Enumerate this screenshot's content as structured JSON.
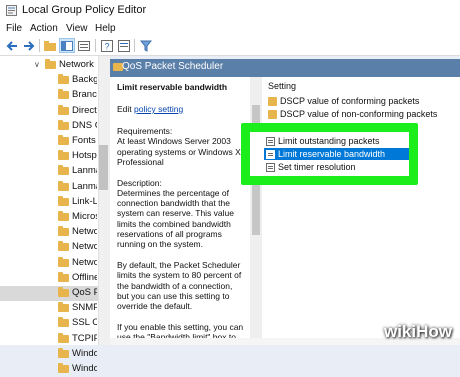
{
  "window": {
    "title": "Local Group Policy Editor"
  },
  "menu": [
    "File",
    "Action",
    "View",
    "Help"
  ],
  "toolbar": {
    "icons": [
      "back-arrow-icon",
      "forward-arrow-icon",
      "up-folder-icon",
      "show-hide-tree-icon",
      "export-list-icon",
      "help-icon",
      "properties-icon",
      "filter-icon"
    ]
  },
  "tree": {
    "items": [
      {
        "label": "Network",
        "indent": 1,
        "expanded": true
      },
      {
        "label": "Backgr",
        "indent": 2
      },
      {
        "label": "Branch",
        "indent": 2
      },
      {
        "label": "DirectA",
        "indent": 2
      },
      {
        "label": "DNS C",
        "indent": 2
      },
      {
        "label": "Fonts",
        "indent": 2
      },
      {
        "label": "Hotspo",
        "indent": 2
      },
      {
        "label": "Lanma",
        "indent": 2
      },
      {
        "label": "Lanma",
        "indent": 2
      },
      {
        "label": "Link-La",
        "indent": 2
      },
      {
        "label": "Micros",
        "indent": 2
      },
      {
        "label": "Netwo",
        "indent": 2
      },
      {
        "label": "Netwo",
        "indent": 2
      },
      {
        "label": "Netwo",
        "indent": 2
      },
      {
        "label": "Offline",
        "indent": 2
      },
      {
        "label": "QoS Pa",
        "indent": 2,
        "selected": true
      },
      {
        "label": "SNMP",
        "indent": 2
      },
      {
        "label": "SSL Co",
        "indent": 2
      },
      {
        "label": "TCPIP",
        "indent": 2
      },
      {
        "label": "Windo",
        "indent": 2
      },
      {
        "label": "Windo",
        "indent": 2
      }
    ]
  },
  "pane": {
    "header": "QoS Packet Scheduler",
    "policy_title": "Limit reservable bandwidth",
    "edit_prefix": "Edit",
    "edit_link": "policy setting",
    "description_lines": [
      "Requirements:",
      "At least Windows Server 2003",
      "operating systems or Windows XP",
      "Professional",
      "",
      "Description:",
      "Determines the percentage of",
      "connection bandwidth that the",
      "system can reserve. This value",
      "limits the combined bandwidth",
      "reservations of all programs",
      "running on the system.",
      "",
      "By default, the Packet Scheduler",
      "limits the system to 80 percent of",
      "the bandwidth of a connection,",
      "but you can use this setting to",
      "override the default.",
      "",
      "If you enable this setting, you can",
      "use the \"Bandwidth limit\" box to"
    ],
    "settings_header": "Setting",
    "settings": [
      {
        "label": "DSCP value of conforming packets",
        "type": "folder"
      },
      {
        "label": "DSCP value of non-conforming packets",
        "type": "folder"
      },
      {
        "label": "Limit outstanding packets",
        "type": "setting"
      },
      {
        "label": "Limit reservable bandwidth",
        "type": "setting",
        "selected": true
      },
      {
        "label": "Set timer resolution",
        "type": "setting"
      }
    ]
  },
  "colors": {
    "highlight": "#1cee1c",
    "selection": "#0078d7",
    "header_bar": "#5a7fa8"
  },
  "watermark": "wikiHow"
}
